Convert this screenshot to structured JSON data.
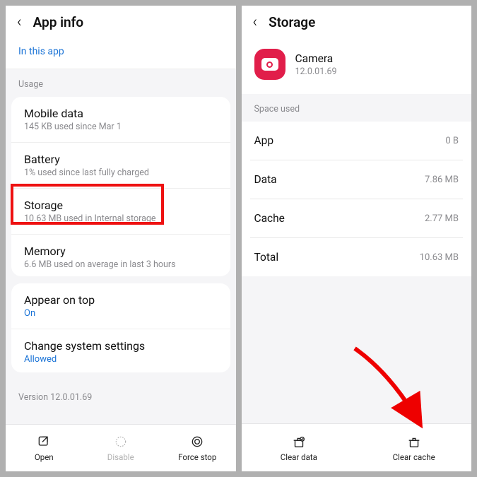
{
  "left": {
    "title": "App info",
    "in_app": "In this app",
    "usage_label": "Usage",
    "mobile_data": {
      "t": "Mobile data",
      "s": "145 KB used since Mar 1"
    },
    "battery": {
      "t": "Battery",
      "s": "1% used since last fully charged"
    },
    "storage": {
      "t": "Storage",
      "s": "10.63 MB used in Internal storage"
    },
    "memory": {
      "t": "Memory",
      "s": "6.6 MB used on average in last 3 hours"
    },
    "appear": {
      "t": "Appear on top",
      "s": "On"
    },
    "change": {
      "t": "Change system settings",
      "s": "Allowed"
    },
    "version": "Version 12.0.01.69",
    "btn_open": "Open",
    "btn_disable": "Disable",
    "btn_force": "Force stop"
  },
  "right": {
    "title": "Storage",
    "app_name": "Camera",
    "app_version": "12.0.01.69",
    "space_label": "Space used",
    "rows": {
      "app": {
        "k": "App",
        "v": "0 B"
      },
      "data": {
        "k": "Data",
        "v": "7.86 MB"
      },
      "cache": {
        "k": "Cache",
        "v": "2.77 MB"
      },
      "total": {
        "k": "Total",
        "v": "10.63 MB"
      }
    },
    "btn_clear_data": "Clear data",
    "btn_clear_cache": "Clear cache"
  }
}
